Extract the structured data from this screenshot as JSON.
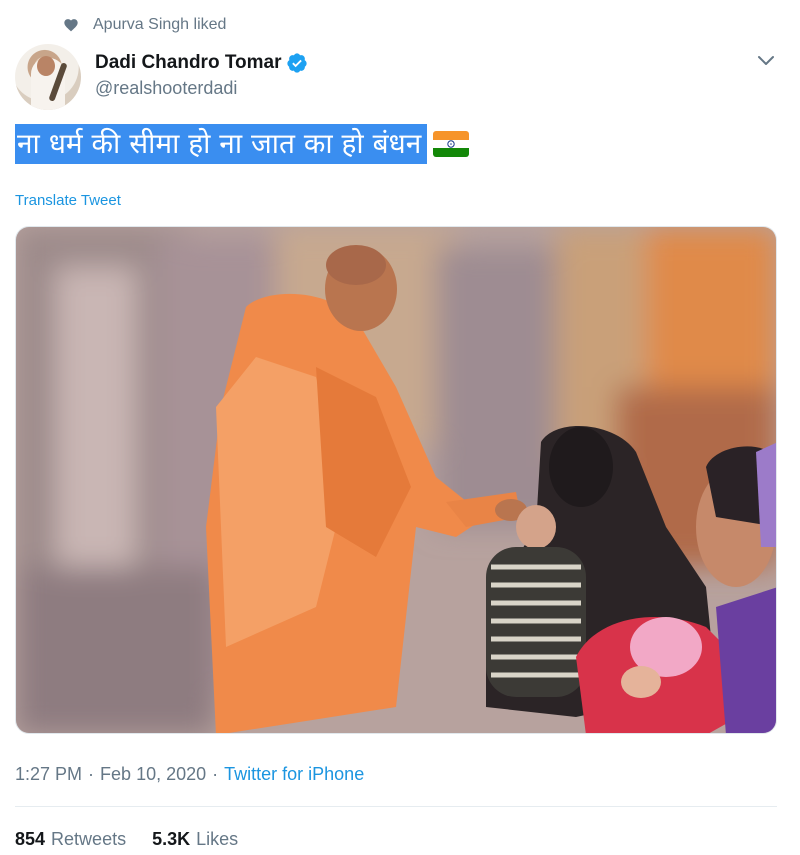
{
  "social_context": {
    "text": "Apurva Singh liked",
    "icon": "heart-icon"
  },
  "author": {
    "display_name": "Dadi Chandro Tomar",
    "handle": "@realshooterdadi",
    "verified": true
  },
  "tweet": {
    "text": "ना धर्म की सीमा हो ना जात का हो बंधन",
    "emoji": "indian-flag",
    "translate_label": "Translate Tweet"
  },
  "meta": {
    "time": "1:27 PM",
    "separator": "·",
    "date": "Feb 10, 2020",
    "source": "Twitter for iPhone"
  },
  "stats": {
    "retweets_count": "854",
    "retweets_label": "Retweets",
    "likes_count": "5.3K",
    "likes_label": "Likes"
  },
  "colors": {
    "accent": "#1b95e0",
    "verified": "#1da1f2",
    "selection_highlight": "#3a8ef0",
    "secondary_text": "#657786"
  }
}
